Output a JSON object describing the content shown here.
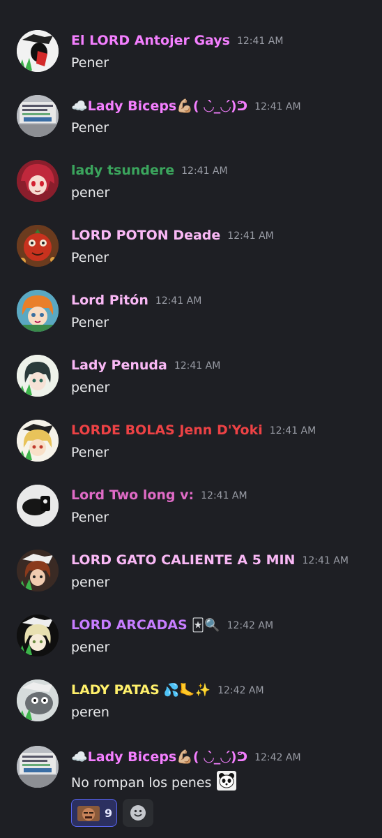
{
  "messages": [
    {
      "author": "El LORD Antojer Gays",
      "color": "#f47fff",
      "time": "12:41 AM",
      "text": "Pener",
      "avatar_icon": "manga-portrait-avatar"
    },
    {
      "author": "☁️Lady Biceps💪🏼( ◡̀_◡́)ᕤ",
      "color": "#f47fff",
      "time": "12:41 AM",
      "text": "Pener",
      "avatar_icon": "sign-photo-avatar"
    },
    {
      "author": "lady tsundere",
      "color": "#3ba55d",
      "time": "12:41 AM",
      "text": "pener",
      "avatar_icon": "anime-redhead-avatar"
    },
    {
      "author": "LORD POTON Deade",
      "color": "#f9b8f5",
      "time": "12:41 AM",
      "text": "Pener",
      "avatar_icon": "cartoon-tomato-avatar"
    },
    {
      "author": "Lord Pitón",
      "color": "#f9b8f5",
      "time": "12:41 AM",
      "text": "Pener",
      "avatar_icon": "anime-orange-hair-avatar"
    },
    {
      "author": "Lady Penuda",
      "color": "#f9b8f5",
      "time": "12:41 AM",
      "text": "pener",
      "avatar_icon": "anime-dark-hair-avatar"
    },
    {
      "author": "LORDE BOLAS Jenn D'Yoki",
      "color": "#ed4245",
      "time": "12:41 AM",
      "text": "Pener",
      "avatar_icon": "anime-blonde-avatar"
    },
    {
      "author": "Lord Two long v:",
      "color": "#e06bc6",
      "time": "12:41 AM",
      "text": "Pener",
      "avatar_icon": "dark-object-avatar"
    },
    {
      "author": "LORD GATO CALIENTE A 5 MIN",
      "color": "#f9b8f5",
      "time": "12:41 AM",
      "text": "pener",
      "avatar_icon": "anime-brown-hair-avatar"
    },
    {
      "author": "LORD ARCADAS",
      "emojis": "🃏🔍",
      "color": "#c77dff",
      "time": "12:42 AM",
      "text": "pener",
      "avatar_icon": "anime-pale-hair-avatar"
    },
    {
      "author": "LADY PATAS",
      "emojis": "💦🦶✨",
      "color": "#fff06b",
      "time": "12:42 AM",
      "text": "peren",
      "avatar_icon": "cartoon-creature-avatar"
    },
    {
      "author": "☁️Lady Biceps💪🏼( ◡̀_◡́)ᕤ",
      "color": "#f47fff",
      "time": "12:42 AM",
      "text": "No rompan los penes",
      "text_emoji": "panda-sticker",
      "avatar_icon": "sign-photo-avatar"
    }
  ],
  "reactions": [
    {
      "emoji": "man-face-emoji",
      "count": "9",
      "active": true
    }
  ],
  "add_reaction_icon": "smiley-add-icon"
}
